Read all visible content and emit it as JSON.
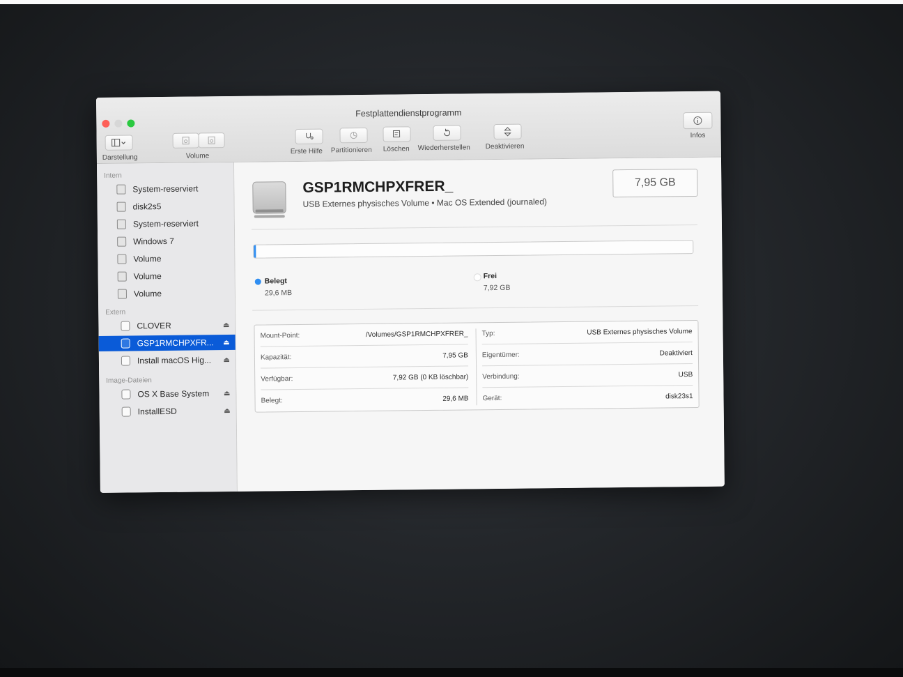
{
  "window": {
    "title": "Festplattendienstprogramm"
  },
  "toolbar": {
    "view_label": "Darstellung",
    "volume_label": "Volume",
    "first_aid_label": "Erste Hilfe",
    "partition_label": "Partitionieren",
    "erase_label": "Löschen",
    "restore_label": "Wiederherstellen",
    "unmount_label": "Deaktivieren",
    "info_label": "Infos"
  },
  "sidebar": {
    "sections": [
      {
        "title": "Intern",
        "items": [
          {
            "label": "System-reserviert"
          },
          {
            "label": "disk2s5"
          },
          {
            "label": "System-reserviert"
          },
          {
            "label": "Windows 7"
          },
          {
            "label": "Volume"
          },
          {
            "label": "Volume"
          },
          {
            "label": "Volume"
          }
        ]
      },
      {
        "title": "Extern",
        "items": [
          {
            "label": "CLOVER"
          },
          {
            "label": "GSP1RMCHPXFR...",
            "selected": true
          },
          {
            "label": "Install macOS Hig..."
          }
        ]
      },
      {
        "title": "Image-Dateien",
        "items": [
          {
            "label": "OS X Base System"
          },
          {
            "label": "InstallESD"
          }
        ]
      }
    ]
  },
  "volume": {
    "name": "GSP1RMCHPXFRER_",
    "description": "USB Externes physisches Volume • Mac OS Extended (journaled)",
    "capacity": "7,95 GB",
    "used_fraction": 0.004
  },
  "usage": {
    "used": {
      "title": "Belegt",
      "value": "29,6 MB",
      "color": "#2f8ef2"
    },
    "free": {
      "title": "Frei",
      "value": "7,92 GB",
      "color": "#ffffff"
    }
  },
  "info": {
    "left": [
      {
        "key": "Mount-Point:",
        "value": "/Volumes/GSP1RMCHPXFRER_"
      },
      {
        "key": "Kapazität:",
        "value": "7,95 GB"
      },
      {
        "key": "Verfügbar:",
        "value": "7,92 GB (0 KB löschbar)"
      },
      {
        "key": "Belegt:",
        "value": "29,6 MB"
      }
    ],
    "right": [
      {
        "key": "Typ:",
        "value": "USB Externes physisches Volume"
      },
      {
        "key": "Eigentümer:",
        "value": "Deaktiviert"
      },
      {
        "key": "Verbindung:",
        "value": "USB"
      },
      {
        "key": "Gerät:",
        "value": "disk23s1"
      }
    ]
  },
  "icons": {
    "sidebar_toggle": "sidebar-icon",
    "first_aid": "stethoscope-icon",
    "partition": "pie-icon",
    "erase": "erase-icon",
    "restore": "restore-icon",
    "unmount": "unmount-icon",
    "info": "info-icon",
    "eject": "⏏"
  }
}
